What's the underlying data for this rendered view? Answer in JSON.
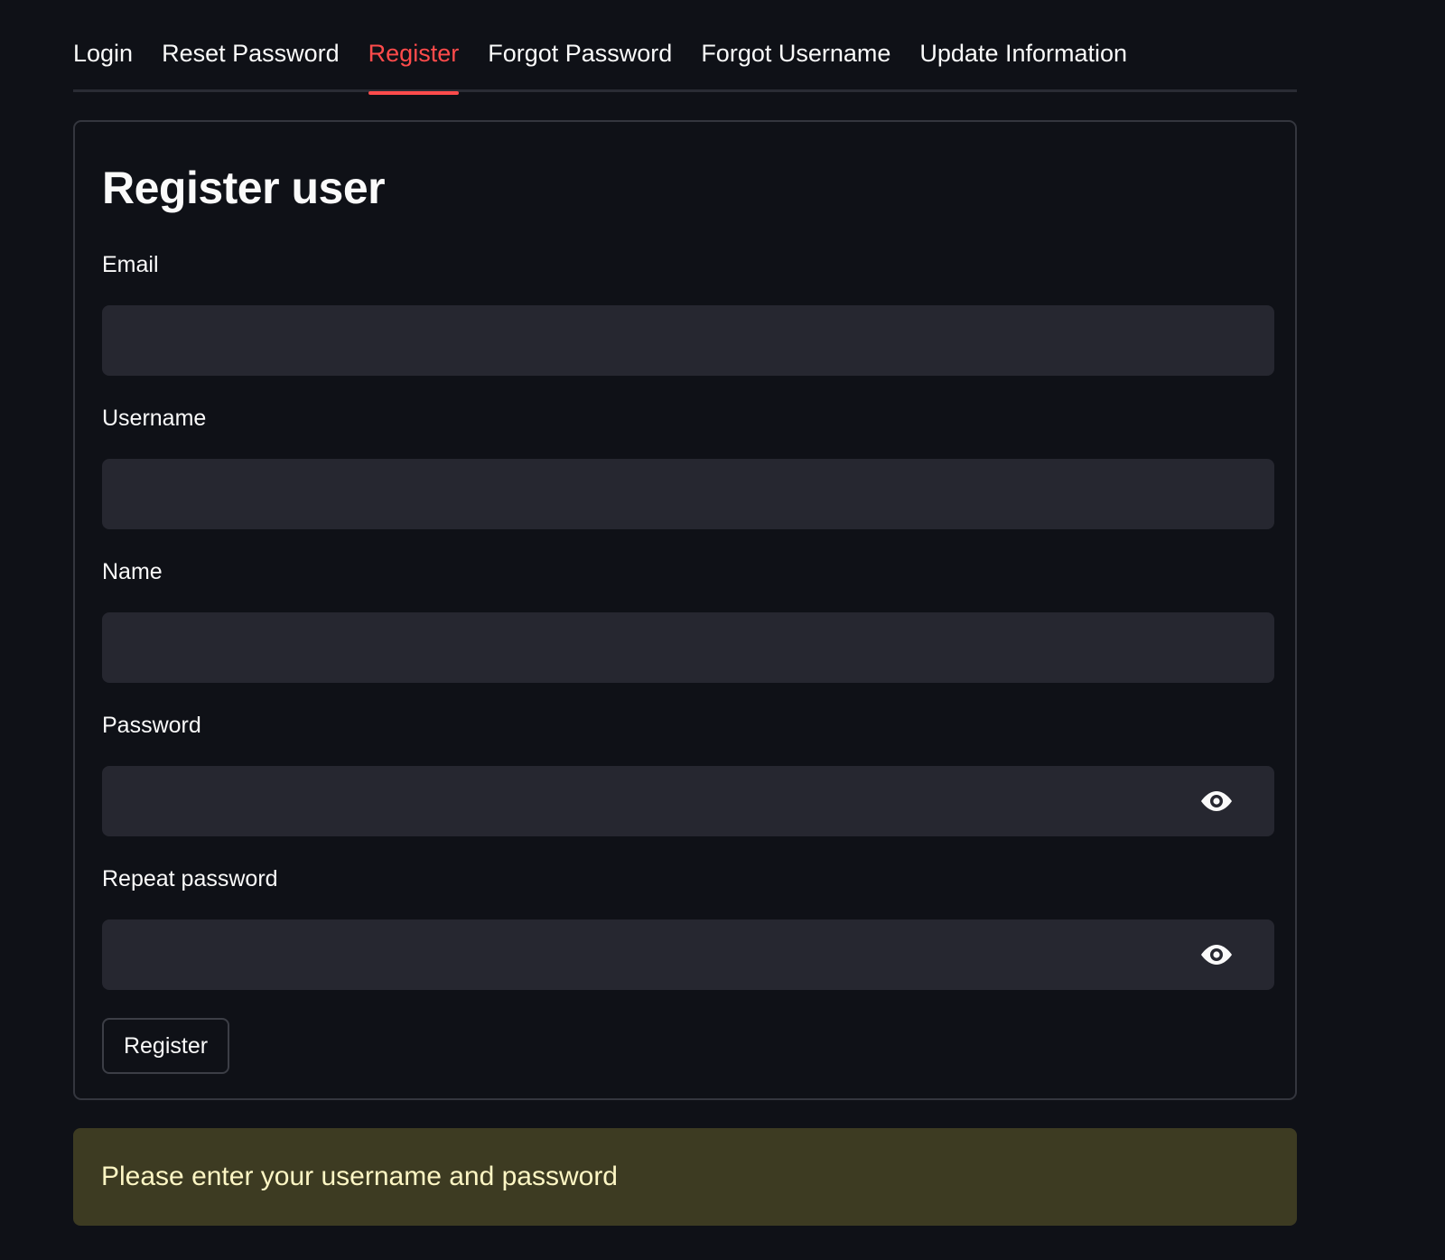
{
  "tabs": [
    {
      "label": "Login",
      "active": false
    },
    {
      "label": "Reset Password",
      "active": false
    },
    {
      "label": "Register",
      "active": true
    },
    {
      "label": "Forgot Password",
      "active": false
    },
    {
      "label": "Forgot Username",
      "active": false
    },
    {
      "label": "Update Information",
      "active": false
    }
  ],
  "form": {
    "title": "Register user",
    "fields": [
      {
        "label": "Email",
        "value": "",
        "type": "text"
      },
      {
        "label": "Username",
        "value": "",
        "type": "text"
      },
      {
        "label": "Name",
        "value": "",
        "type": "text"
      },
      {
        "label": "Password",
        "value": "",
        "type": "password",
        "icon": "eye-icon"
      },
      {
        "label": "Repeat password",
        "value": "",
        "type": "password",
        "icon": "eye-icon"
      }
    ],
    "submit_label": "Register"
  },
  "warning": {
    "text": "Please enter your username and password"
  },
  "colors": {
    "background": "#0f1117",
    "accent": "#ff4b4b",
    "input_bg": "#262730",
    "warning_bg": "#3d3b22",
    "warning_text": "#fdf6c4"
  }
}
